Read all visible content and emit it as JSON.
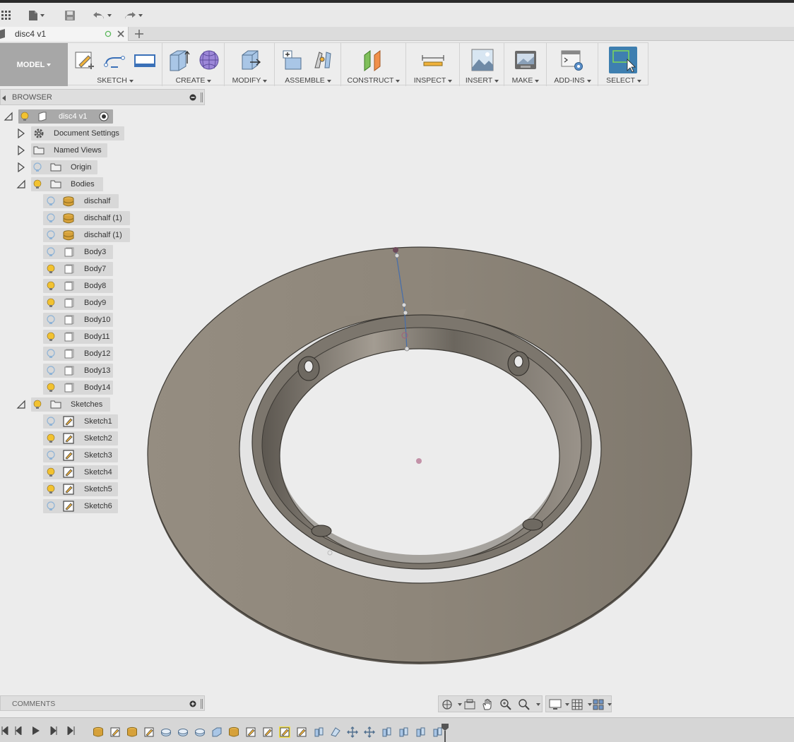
{
  "document": {
    "tab_title": "disc4 v1"
  },
  "toolbar": {
    "workspace": "MODEL",
    "groups": {
      "sketch": "SKETCH",
      "create": "CREATE",
      "modify": "MODIFY",
      "assemble": "ASSEMBLE",
      "construct": "CONSTRUCT",
      "inspect": "INSPECT",
      "insert": "INSERT",
      "make": "MAKE",
      "addins": "ADD-INS",
      "select": "SELECT"
    }
  },
  "browser": {
    "title": "BROWSER",
    "root": "disc4 v1",
    "document_settings": "Document Settings",
    "named_views": "Named Views",
    "origin": "Origin",
    "bodies_folder": "Bodies",
    "bodies": [
      {
        "name": "dischalf",
        "type": "component",
        "visible": false
      },
      {
        "name": "dischalf (1)",
        "type": "component",
        "visible": false
      },
      {
        "name": "dischalf (1)",
        "type": "component",
        "visible": false
      },
      {
        "name": "Body3",
        "type": "body",
        "visible": false
      },
      {
        "name": "Body7",
        "type": "body",
        "visible": true
      },
      {
        "name": "Body8",
        "type": "body",
        "visible": true
      },
      {
        "name": "Body9",
        "type": "body",
        "visible": true
      },
      {
        "name": "Body10",
        "type": "body",
        "visible": false
      },
      {
        "name": "Body11",
        "type": "body",
        "visible": true
      },
      {
        "name": "Body12",
        "type": "body",
        "visible": false
      },
      {
        "name": "Body13",
        "type": "body",
        "visible": false
      },
      {
        "name": "Body14",
        "type": "body",
        "visible": true
      }
    ],
    "sketches_folder": "Sketches",
    "sketches": [
      {
        "name": "Sketch1",
        "visible": false
      },
      {
        "name": "Sketch2",
        "visible": true
      },
      {
        "name": "Sketch3",
        "visible": false
      },
      {
        "name": "Sketch4",
        "visible": true
      },
      {
        "name": "Sketch5",
        "visible": true
      },
      {
        "name": "Sketch6",
        "visible": false
      }
    ]
  },
  "comments": {
    "label": "COMMENTS"
  },
  "colors": {
    "model_button": "#a7a7a7",
    "bulb_on": "#f2c230",
    "bulb_off": "#8fb3d6",
    "disc_face": "#8f877b",
    "select_active": "#3e7fb0"
  }
}
